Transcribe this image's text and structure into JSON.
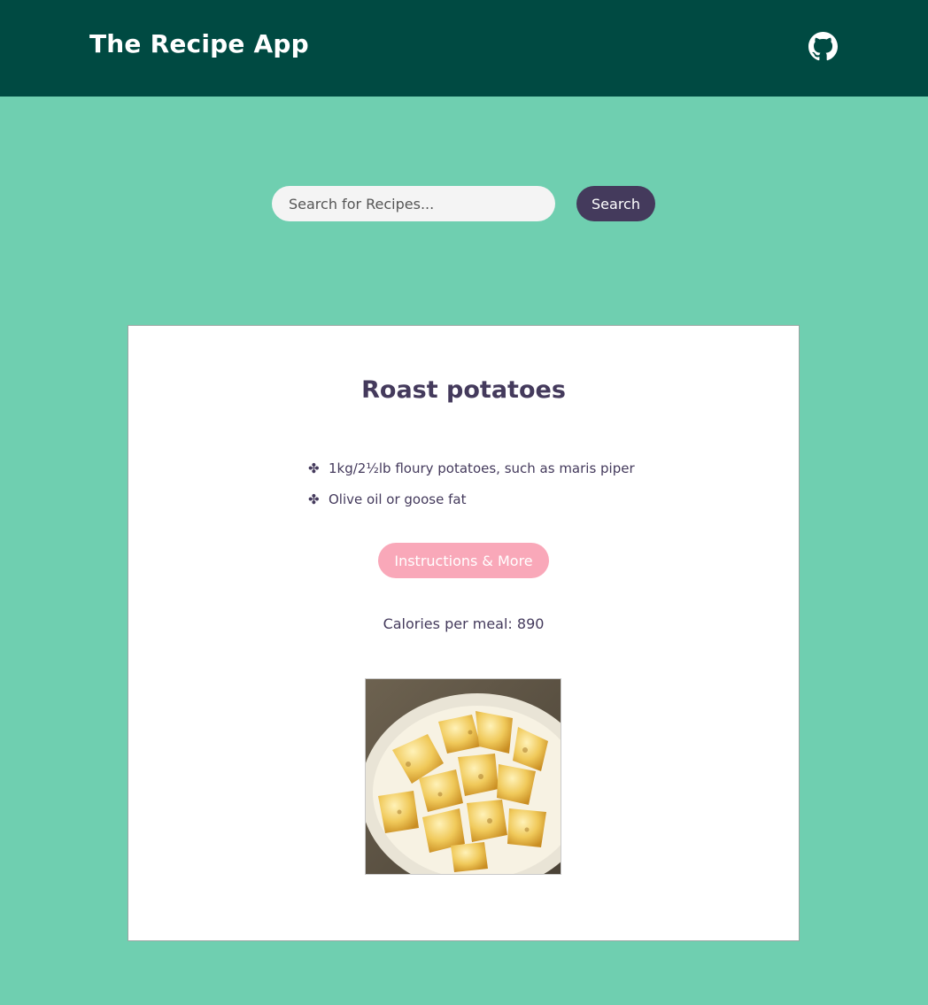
{
  "header": {
    "brand": "The Recipe App",
    "github_icon": "github-icon"
  },
  "search": {
    "placeholder": "Search for Recipes...",
    "value": "",
    "button_label": "Search"
  },
  "recipe": {
    "title": "Roast potatoes",
    "bullet": "✤",
    "ingredients": [
      "1kg/2½lb floury potatoes, such as maris piper",
      "Olive oil or goose fat"
    ],
    "instructions_label": "Instructions & More",
    "calories_label": "Calories per meal: 890"
  },
  "colors": {
    "header_bg": "#004a42",
    "page_bg": "#6fcfb0",
    "primary_purple": "#443a5c",
    "accent_pink": "#f9a8b9"
  }
}
